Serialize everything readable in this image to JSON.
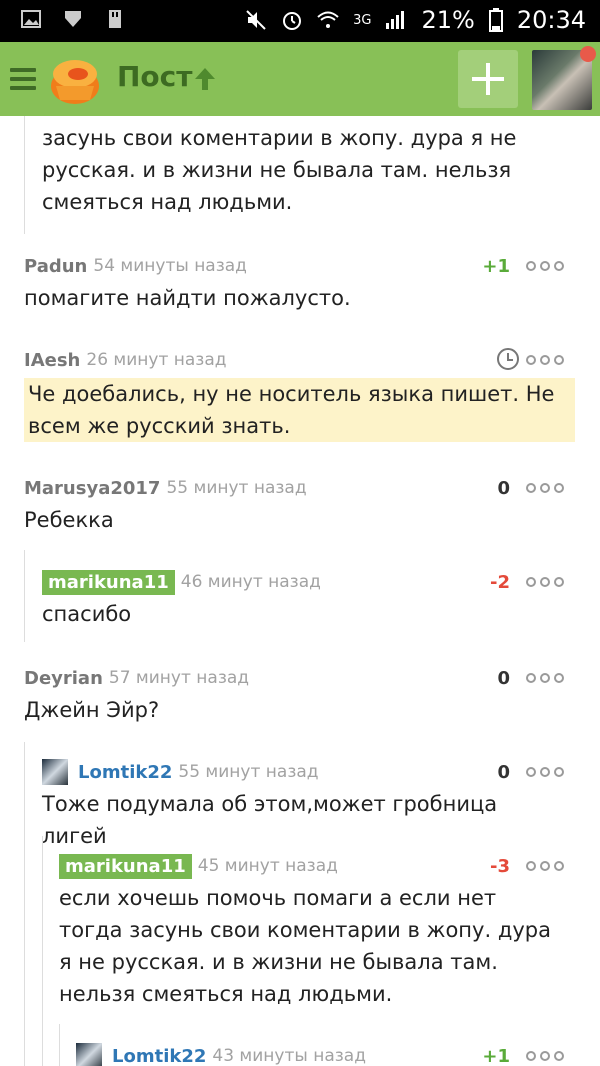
{
  "status_bar": {
    "battery": "21%",
    "time": "20:34",
    "network": "3G"
  },
  "app_bar": {
    "title": "Пост",
    "icons": [
      "menu-icon",
      "pikabu-logo",
      "arrow-up-icon",
      "plus-icon",
      "avatar"
    ]
  },
  "comments": [
    {
      "author": "",
      "time": "",
      "rating": "",
      "text": "засунь свои коментарии в жопу. дура я не русская. и в жизни не бывала там. нельзя смеяться над людьми."
    },
    {
      "author": "Padun",
      "time": "54 минуты назад",
      "rating": "+1",
      "text": "помагите найдти пожалусто."
    },
    {
      "author": "IAesh",
      "time": "26 минут назад",
      "rating": "",
      "text": "Че доебались, ну не носитель языка пишет. Не всем же русский знать."
    },
    {
      "author": "Marusya2017",
      "time": "55 минут назад",
      "rating": "0",
      "text": "Ребекка"
    },
    {
      "author": "marikuna11",
      "time": "46 минут назад",
      "rating": "-2",
      "text": "спасибо"
    },
    {
      "author": "Deyrian",
      "time": "57 минут назад",
      "rating": "0",
      "text": "Джейн Эйр?"
    },
    {
      "author": "Lomtik22",
      "time": "55 минут назад",
      "rating": "0",
      "text": "Тоже подумала об этом,может гробница лигей"
    },
    {
      "author": "marikuna11",
      "time": "45 минут назад",
      "rating": "-3",
      "text": "если хочешь помочь помаги а если нет тогда засунь свои коментарии в жопу. дура я не русская. и в жизни не бывала там. нельзя смеяться над людьми."
    },
    {
      "author": "Lomtik22",
      "time": "43 минуты назад",
      "rating": "+1",
      "text": ""
    }
  ],
  "colors": {
    "app_bar": "#88c057",
    "title": "#3d6b22",
    "positive": "#5aab3a",
    "negative": "#e44a3a",
    "highlight": "#fdf3c9"
  }
}
